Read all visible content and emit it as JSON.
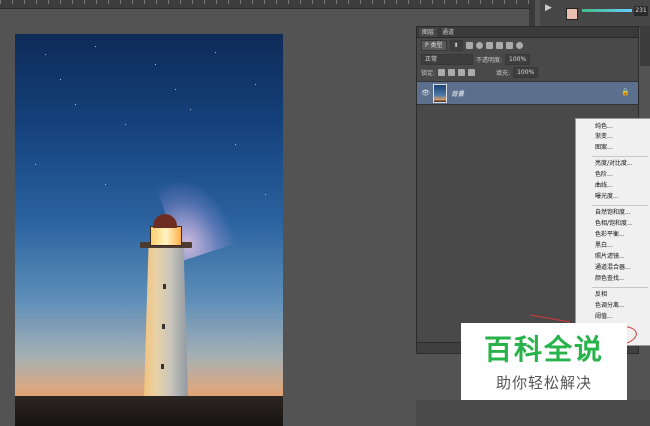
{
  "layers_panel": {
    "tabs": [
      "图层",
      "通道"
    ],
    "filter": {
      "kind_label": "P 类型"
    },
    "blend_mode": "正常",
    "opacity": {
      "label": "不透明度:",
      "value": "100%"
    },
    "lock_label": "锁定:",
    "fill": {
      "label": "填充:",
      "value": "100%"
    },
    "layers": [
      {
        "name": "背景",
        "visible": true,
        "locked": true
      }
    ]
  },
  "right_top": {
    "play_icon": "play-icon",
    "number": "231"
  },
  "context_menu": {
    "groups": [
      [
        "纯色...",
        "渐变...",
        "图案..."
      ],
      [
        "亮度/对比度...",
        "色阶...",
        "曲线...",
        "曝光度..."
      ],
      [
        "自然饱和度...",
        "色相/饱和度...",
        "色彩平衡...",
        "黑白...",
        "照片滤镜...",
        "通道混合器...",
        "颜色查找..."
      ],
      [
        "反相",
        "色调分离...",
        "阈值..."
      ]
    ]
  },
  "watermark": {
    "title": "百科全说",
    "subtitle": "助你轻松解决",
    "color": "#27b34a"
  },
  "annotation_color": "#d43a3a"
}
